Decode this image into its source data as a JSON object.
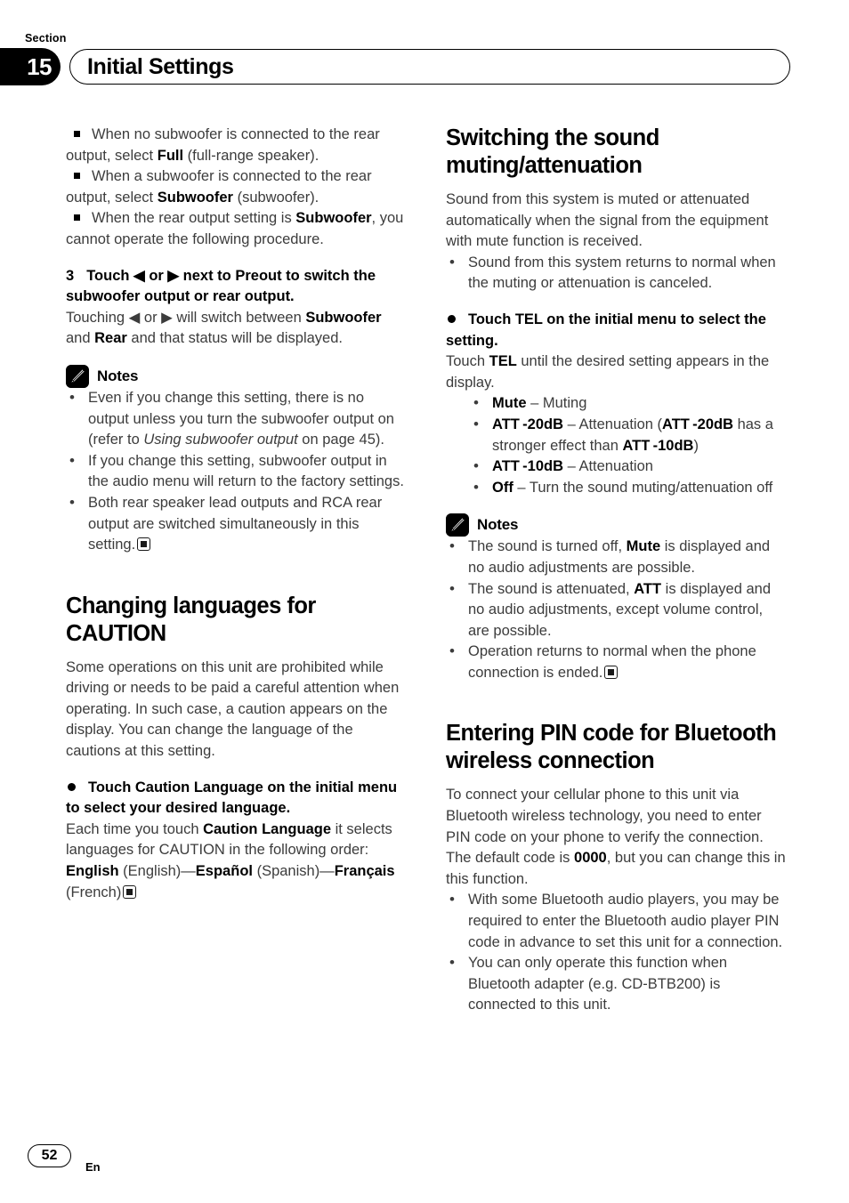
{
  "header": {
    "section_label": "Section",
    "section_number": "15",
    "title": "Initial Settings"
  },
  "footer": {
    "page_number": "52",
    "language_code": "En"
  },
  "left_column": {
    "square_bullets": [
      "When no subwoofer is connected to the rear output, select ",
      "When a subwoofer is connected to the rear output, select ",
      "When the rear output setting is "
    ],
    "sq1_bold": "Full",
    "sq1_tail": " (full-range speaker).",
    "sq2_bold": "Subwoofer",
    "sq2_tail": " (subwoofer).",
    "sq3_bold": "Subwoofer",
    "sq3_tail": ", you cannot operate the following procedure.",
    "step": {
      "number": "3",
      "text_a": "Touch ◀ or ▶ next to Preout to switch the subwoofer output or rear output."
    },
    "step_body_a": "Touching ◀ or ▶ will switch between ",
    "step_body_b": "Subwoofer",
    "step_body_c": " and ",
    "step_body_d": "Rear",
    "step_body_e": " and that status will be displayed.",
    "notes_label": "Notes",
    "notes": [
      {
        "a": "Even if you change this setting, there is no output unless you turn the subwoofer output on (refer to ",
        "italic": "Using subwoofer output",
        "b": " on page 45).",
        "endmark": false
      },
      {
        "a": "If you change this setting, subwoofer output in the audio menu will return to the factory settings.",
        "italic": "",
        "b": "",
        "endmark": false
      },
      {
        "a": "Both rear speaker lead outputs and RCA rear output are switched simultaneously in this setting.",
        "italic": "",
        "b": "",
        "endmark": true
      }
    ],
    "heading2": "Changing languages for CAUTION",
    "intro": "Some operations on this unit are prohibited while driving or needs to be paid a careful attention when operating. In such case, a caution appears on the display. You can change the language of the cautions at this setting.",
    "circ_head": "Touch Caution Language on the initial menu to select your desired language.",
    "circ_body_a": "Each time you touch ",
    "circ_body_bold": "Caution Language",
    "circ_body_b": " it selects languages for CAUTION in the following order:",
    "lang_order": {
      "l1_bold": "English",
      "l1_plain": " (English)—",
      "l2_bold": "Español",
      "l2_plain": " (Spanish)—",
      "l3_bold": "Français",
      "l3_plain": " (French)"
    }
  },
  "right_column": {
    "heading1": "Switching the sound muting/attenuation",
    "intro": "Sound from this system is muted or attenuated automatically when the signal from the equipment with mute function is received.",
    "intro_bullet": "Sound from this system returns to normal when the muting or attenuation is canceled.",
    "circ_head": "Touch TEL on the initial menu to select the setting.",
    "circ_body_a": "Touch ",
    "circ_body_bold": "TEL",
    "circ_body_b": " until the desired setting appears in the display.",
    "settings": [
      {
        "name": "Mute",
        "sep": " – ",
        "desc_a": "Muting",
        "desc_bold": "",
        "desc_b": ""
      },
      {
        "name": "ATT -20dB",
        "sep": " – ",
        "desc_a": "Attenuation (",
        "desc_bold": "ATT -20dB",
        "desc_b": " has a stronger effect than ",
        "desc_bold2": "ATT -10dB",
        "desc_c": ")"
      },
      {
        "name": "ATT -10dB",
        "sep": " – ",
        "desc_a": "Attenuation",
        "desc_bold": "",
        "desc_b": ""
      },
      {
        "name": "Off",
        "sep": " – ",
        "desc_a": "Turn the sound muting/attenuation off",
        "desc_bold": "",
        "desc_b": ""
      }
    ],
    "notes_label": "Notes",
    "notes": [
      {
        "a": "The sound is turned off, ",
        "bold": "Mute",
        "b": " is displayed and no audio adjustments are possible.",
        "endmark": false
      },
      {
        "a": "The sound is attenuated, ",
        "bold": "ATT",
        "b": " is displayed and no audio adjustments, except volume control, are possible.",
        "endmark": false
      },
      {
        "a": "Operation returns to normal when the phone connection is ended.",
        "bold": "",
        "b": "",
        "endmark": true
      }
    ],
    "heading2": "Entering PIN code for Bluetooth wireless connection",
    "pin_intro_a": "To connect your cellular phone to this unit via Bluetooth wireless technology, you need to enter PIN code on your phone to verify the connection. The default code is ",
    "pin_intro_bold": "0000",
    "pin_intro_b": ", but you can change this in this function.",
    "pin_bullets": [
      "With some Bluetooth audio players, you may be required to enter the Bluetooth audio player PIN code in advance to set this unit for a connection.",
      "You can only operate this function when Bluetooth adapter (e.g. CD-BTB200) is connected to this unit."
    ]
  },
  "colors": {
    "body_text": "#3c3c3c",
    "heading": "#000000",
    "accent": "#000000"
  }
}
